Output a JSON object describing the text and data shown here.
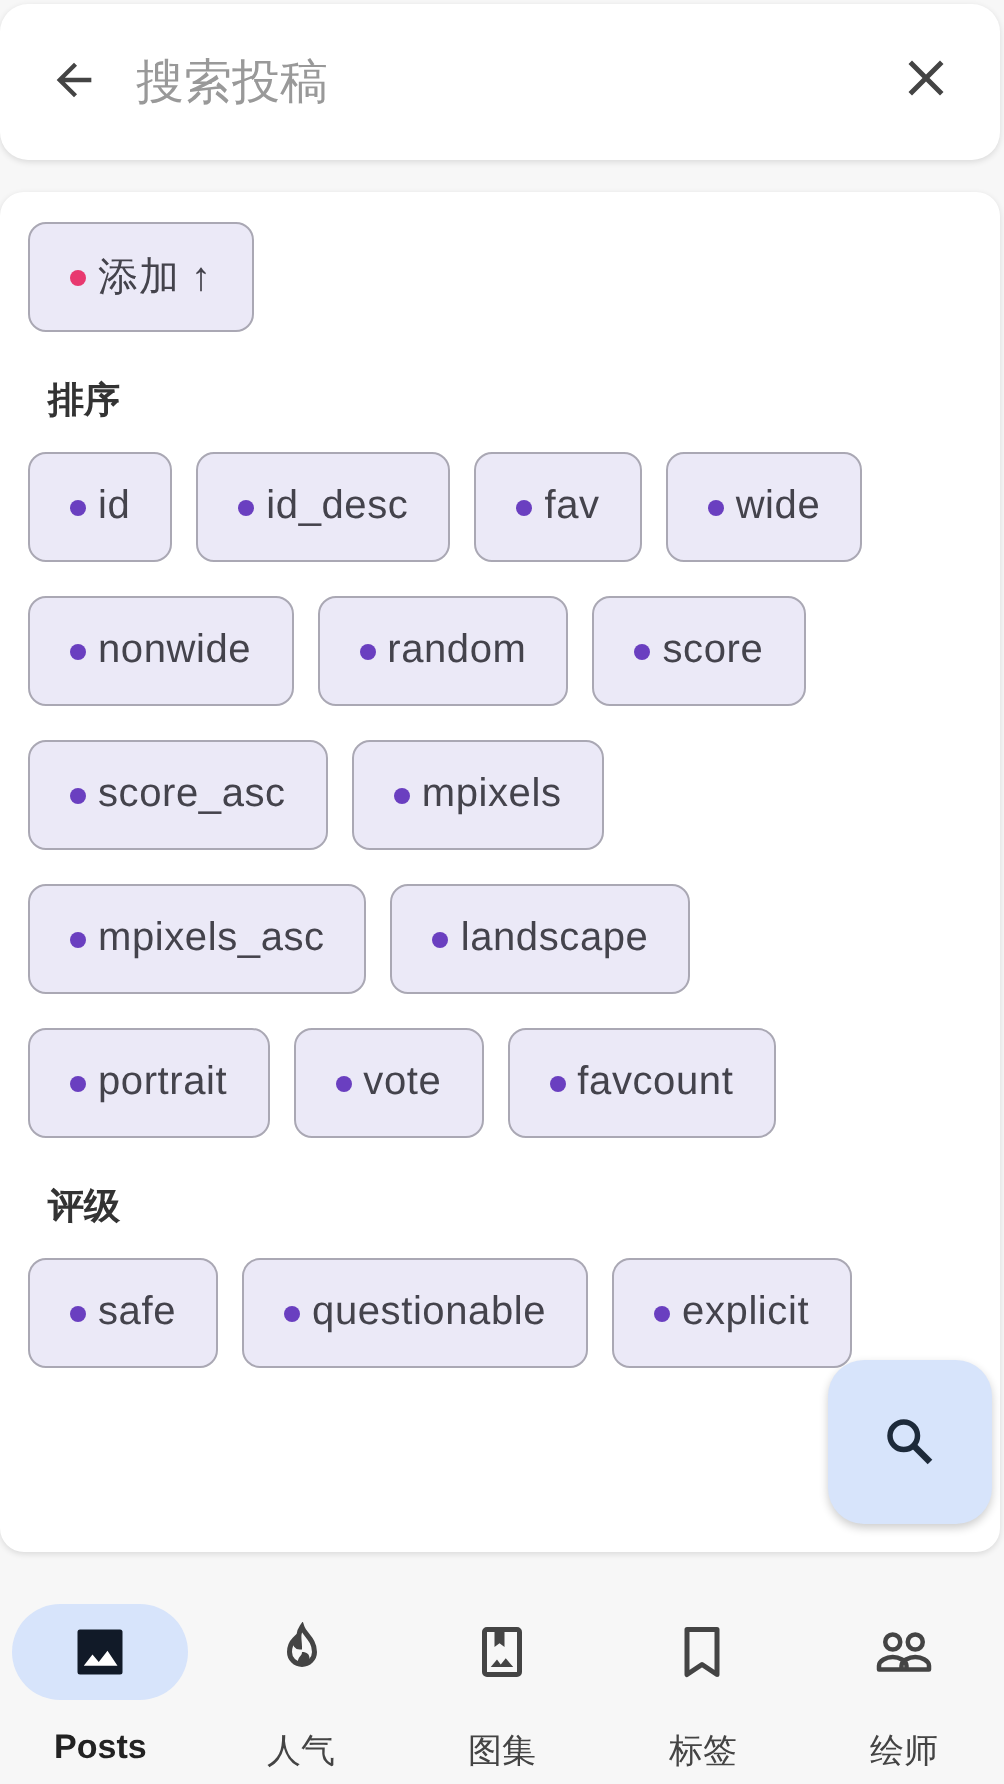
{
  "search": {
    "placeholder": "搜索投稿"
  },
  "add_chip": {
    "label": "添加 ↑",
    "color": "#e8386f"
  },
  "sections": [
    {
      "title": "排序",
      "chips": [
        {
          "label": "id",
          "color": "#6a3fc0"
        },
        {
          "label": "id_desc",
          "color": "#6a3fc0"
        },
        {
          "label": "fav",
          "color": "#6a3fc0"
        },
        {
          "label": "wide",
          "color": "#6a3fc0"
        },
        {
          "label": "nonwide",
          "color": "#6a3fc0"
        },
        {
          "label": "random",
          "color": "#6a3fc0"
        },
        {
          "label": "score",
          "color": "#6a3fc0"
        },
        {
          "label": "score_asc",
          "color": "#6a3fc0"
        },
        {
          "label": "mpixels",
          "color": "#6a3fc0"
        },
        {
          "label": "mpixels_asc",
          "color": "#6a3fc0"
        },
        {
          "label": "landscape",
          "color": "#6a3fc0"
        },
        {
          "label": "portrait",
          "color": "#6a3fc0"
        },
        {
          "label": "vote",
          "color": "#6a3fc0"
        },
        {
          "label": "favcount",
          "color": "#6a3fc0"
        }
      ]
    },
    {
      "title": "评级",
      "chips": [
        {
          "label": "safe",
          "color": "#6a3fc0"
        },
        {
          "label": "questionable",
          "color": "#6a3fc0"
        },
        {
          "label": "explicit",
          "color": "#6a3fc0"
        }
      ]
    }
  ],
  "nav": [
    {
      "label": "Posts",
      "kind": "image",
      "selected": true
    },
    {
      "label": "人气",
      "kind": "fire",
      "selected": false
    },
    {
      "label": "图集",
      "kind": "album",
      "selected": false
    },
    {
      "label": "标签",
      "kind": "bookmark",
      "selected": false
    },
    {
      "label": "绘师",
      "kind": "people",
      "selected": false
    }
  ]
}
